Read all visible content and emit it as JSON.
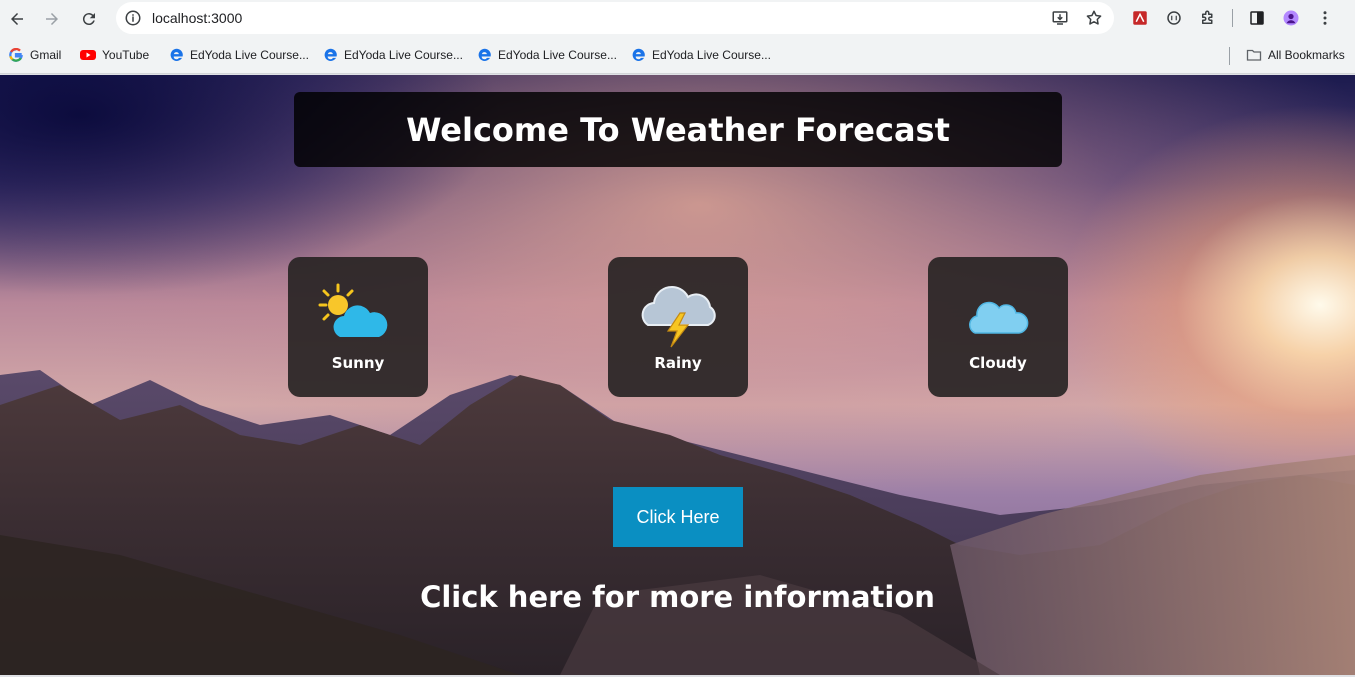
{
  "browser": {
    "url": "localhost:3000",
    "bookmarks": [
      {
        "label": "Gmail",
        "icon": "gmail-icon"
      },
      {
        "label": "YouTube",
        "icon": "youtube-icon"
      },
      {
        "label": "EdYoda Live Course...",
        "icon": "edge-icon"
      },
      {
        "label": "EdYoda Live Course...",
        "icon": "edge-icon"
      },
      {
        "label": "EdYoda Live Course...",
        "icon": "edge-icon"
      },
      {
        "label": "EdYoda Live Course...",
        "icon": "edge-icon"
      }
    ],
    "all_bookmarks": "All Bookmarks"
  },
  "page": {
    "title": "Welcome To Weather Forecast",
    "cards": [
      {
        "label": "Sunny",
        "icon": "sun-behind-cloud-icon"
      },
      {
        "label": "Rainy",
        "icon": "thunder-cloud-icon"
      },
      {
        "label": "Cloudy",
        "icon": "cloud-icon"
      }
    ],
    "button_label": "Click Here",
    "info_text": "Click here for more information"
  },
  "colors": {
    "button": "#0a8fc2",
    "title_bg": "#000000",
    "card_bg": "#282424"
  }
}
